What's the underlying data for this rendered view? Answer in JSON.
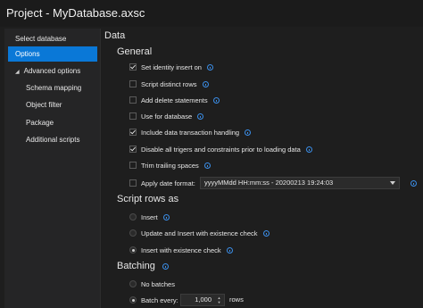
{
  "title": "Project - MyDatabase.axsc",
  "sidebar": {
    "items": [
      {
        "label": "Select database"
      },
      {
        "label": "Options"
      },
      {
        "label": "Advanced options"
      },
      {
        "label": "Schema mapping"
      },
      {
        "label": "Object filter"
      },
      {
        "label": "Package"
      },
      {
        "label": "Additional scripts"
      }
    ]
  },
  "main": {
    "heading": "Data",
    "general": {
      "heading": "General",
      "options": [
        {
          "label": "Set identity insert on",
          "checked": true
        },
        {
          "label": "Script distinct rows",
          "checked": false
        },
        {
          "label": "Add delete statements",
          "checked": false
        },
        {
          "label": "Use for database",
          "checked": false
        },
        {
          "label": "Include data transaction handling",
          "checked": true
        },
        {
          "label": "Disable all trigers and constraints prior to loading data",
          "checked": true
        },
        {
          "label": "Trim trailing spaces",
          "checked": false
        },
        {
          "label": "Apply date format:",
          "checked": false
        }
      ],
      "date_format_value": "yyyyMMdd HH:mm:ss - 20200213 19:24:03"
    },
    "script_rows": {
      "heading": "Script rows as",
      "options": [
        {
          "label": "Insert",
          "selected": false
        },
        {
          "label": "Update and Insert with existence check",
          "selected": false
        },
        {
          "label": "Insert with existence check",
          "selected": true
        }
      ]
    },
    "batching": {
      "heading": "Batching",
      "no_batches_label": "No batches",
      "batch_every_label": "Batch every:",
      "batch_value": "1,000",
      "rows_label": "rows"
    }
  },
  "colors": {
    "accent": "#0a78d7",
    "info": "#3b8ee8",
    "background": "#1e1e1e"
  }
}
